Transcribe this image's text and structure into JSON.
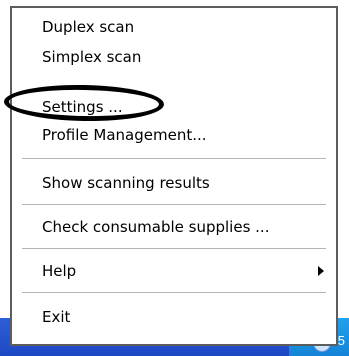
{
  "menu": {
    "items": [
      {
        "label": "Duplex scan"
      },
      {
        "label": "Simplex scan"
      },
      {
        "label": "Settings ..."
      },
      {
        "label": "Profile Management..."
      },
      {
        "label": "Show scanning results"
      },
      {
        "label": "Check consumable supplies ..."
      },
      {
        "label": "Help"
      },
      {
        "label": "Exit"
      }
    ]
  },
  "tray": {
    "digit": "5"
  }
}
